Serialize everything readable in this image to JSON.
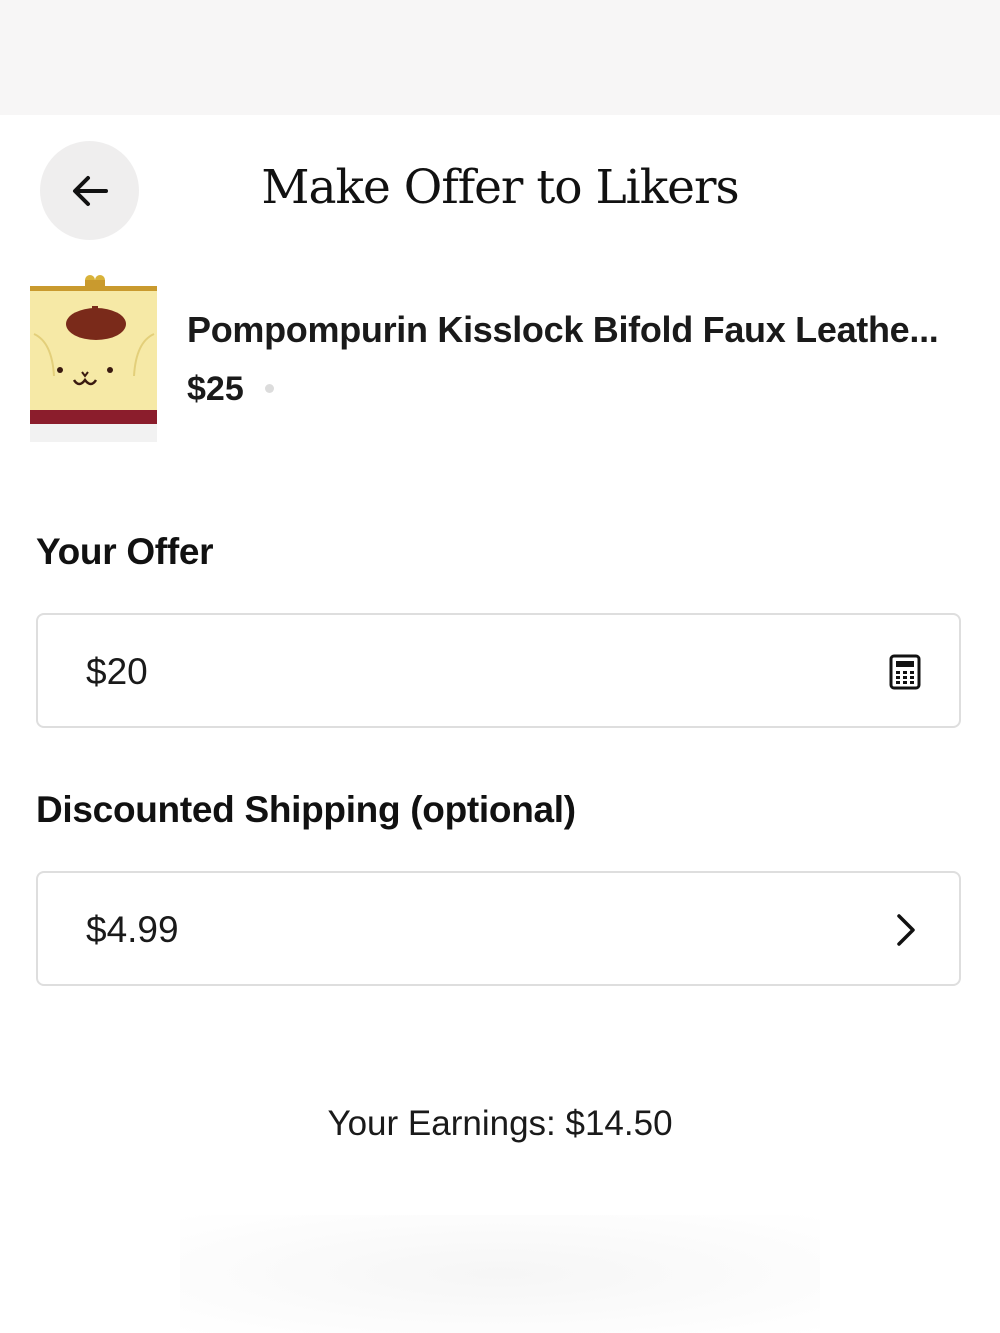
{
  "header": {
    "title": "Make Offer to Likers",
    "back_icon": "arrow-left-icon"
  },
  "product": {
    "title": "Pompompurin Kisslock Bifold Faux Leathe...",
    "price": "$25"
  },
  "offer": {
    "label": "Your Offer",
    "value": "$20",
    "icon": "calculator-icon"
  },
  "shipping": {
    "label": "Discounted Shipping (optional)",
    "value": "$4.99",
    "icon": "chevron-right-icon"
  },
  "earnings": {
    "text": "Your Earnings: $14.50"
  },
  "colors": {
    "back_button_bg": "#efeeee",
    "field_border": "#dedede",
    "thumb_yellow": "#f6e9a6",
    "thumb_brown": "#7a2a1a",
    "thumb_strap": "#8b1d2c"
  }
}
